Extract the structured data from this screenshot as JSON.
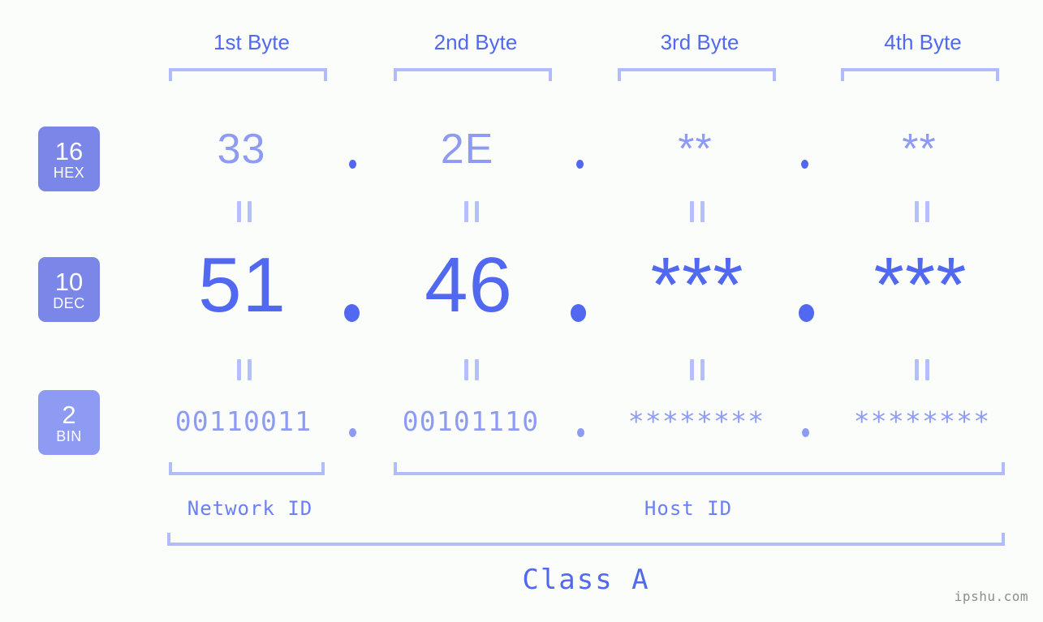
{
  "page": {
    "background_color": "#fbfdfa",
    "accent_color": "#5168f0",
    "accent_light_color": "#8e9bf2",
    "bracket_color": "#b2bcfb",
    "badge_color": "#7b87e8",
    "watermark": "ipshu.com"
  },
  "headers": [
    {
      "label": "1st Byte"
    },
    {
      "label": "2nd Byte"
    },
    {
      "label": "3rd Byte"
    },
    {
      "label": "4th Byte"
    }
  ],
  "bases": [
    {
      "number": "16",
      "name": "HEX"
    },
    {
      "number": "10",
      "name": "DEC"
    },
    {
      "number": "2",
      "name": "BIN"
    }
  ],
  "rows": {
    "hex": {
      "base_number": "16",
      "base_name": "HEX",
      "values": [
        "33",
        "2E",
        "**",
        "**"
      ],
      "separator": "."
    },
    "dec": {
      "base_number": "10",
      "base_name": "DEC",
      "values": [
        "51",
        "46",
        "***",
        "***"
      ],
      "separator": "."
    },
    "bin": {
      "base_number": "2",
      "base_name": "BIN",
      "values": [
        "00110011",
        "00101110",
        "********",
        "********"
      ],
      "separator": "."
    }
  },
  "equals_marks": {
    "glyph": "||",
    "count_per_gap": 4,
    "gaps": 2
  },
  "segments": {
    "network_id": {
      "label": "Network ID"
    },
    "host_id": {
      "label": "Host ID"
    },
    "class": {
      "label": "Class A"
    }
  }
}
